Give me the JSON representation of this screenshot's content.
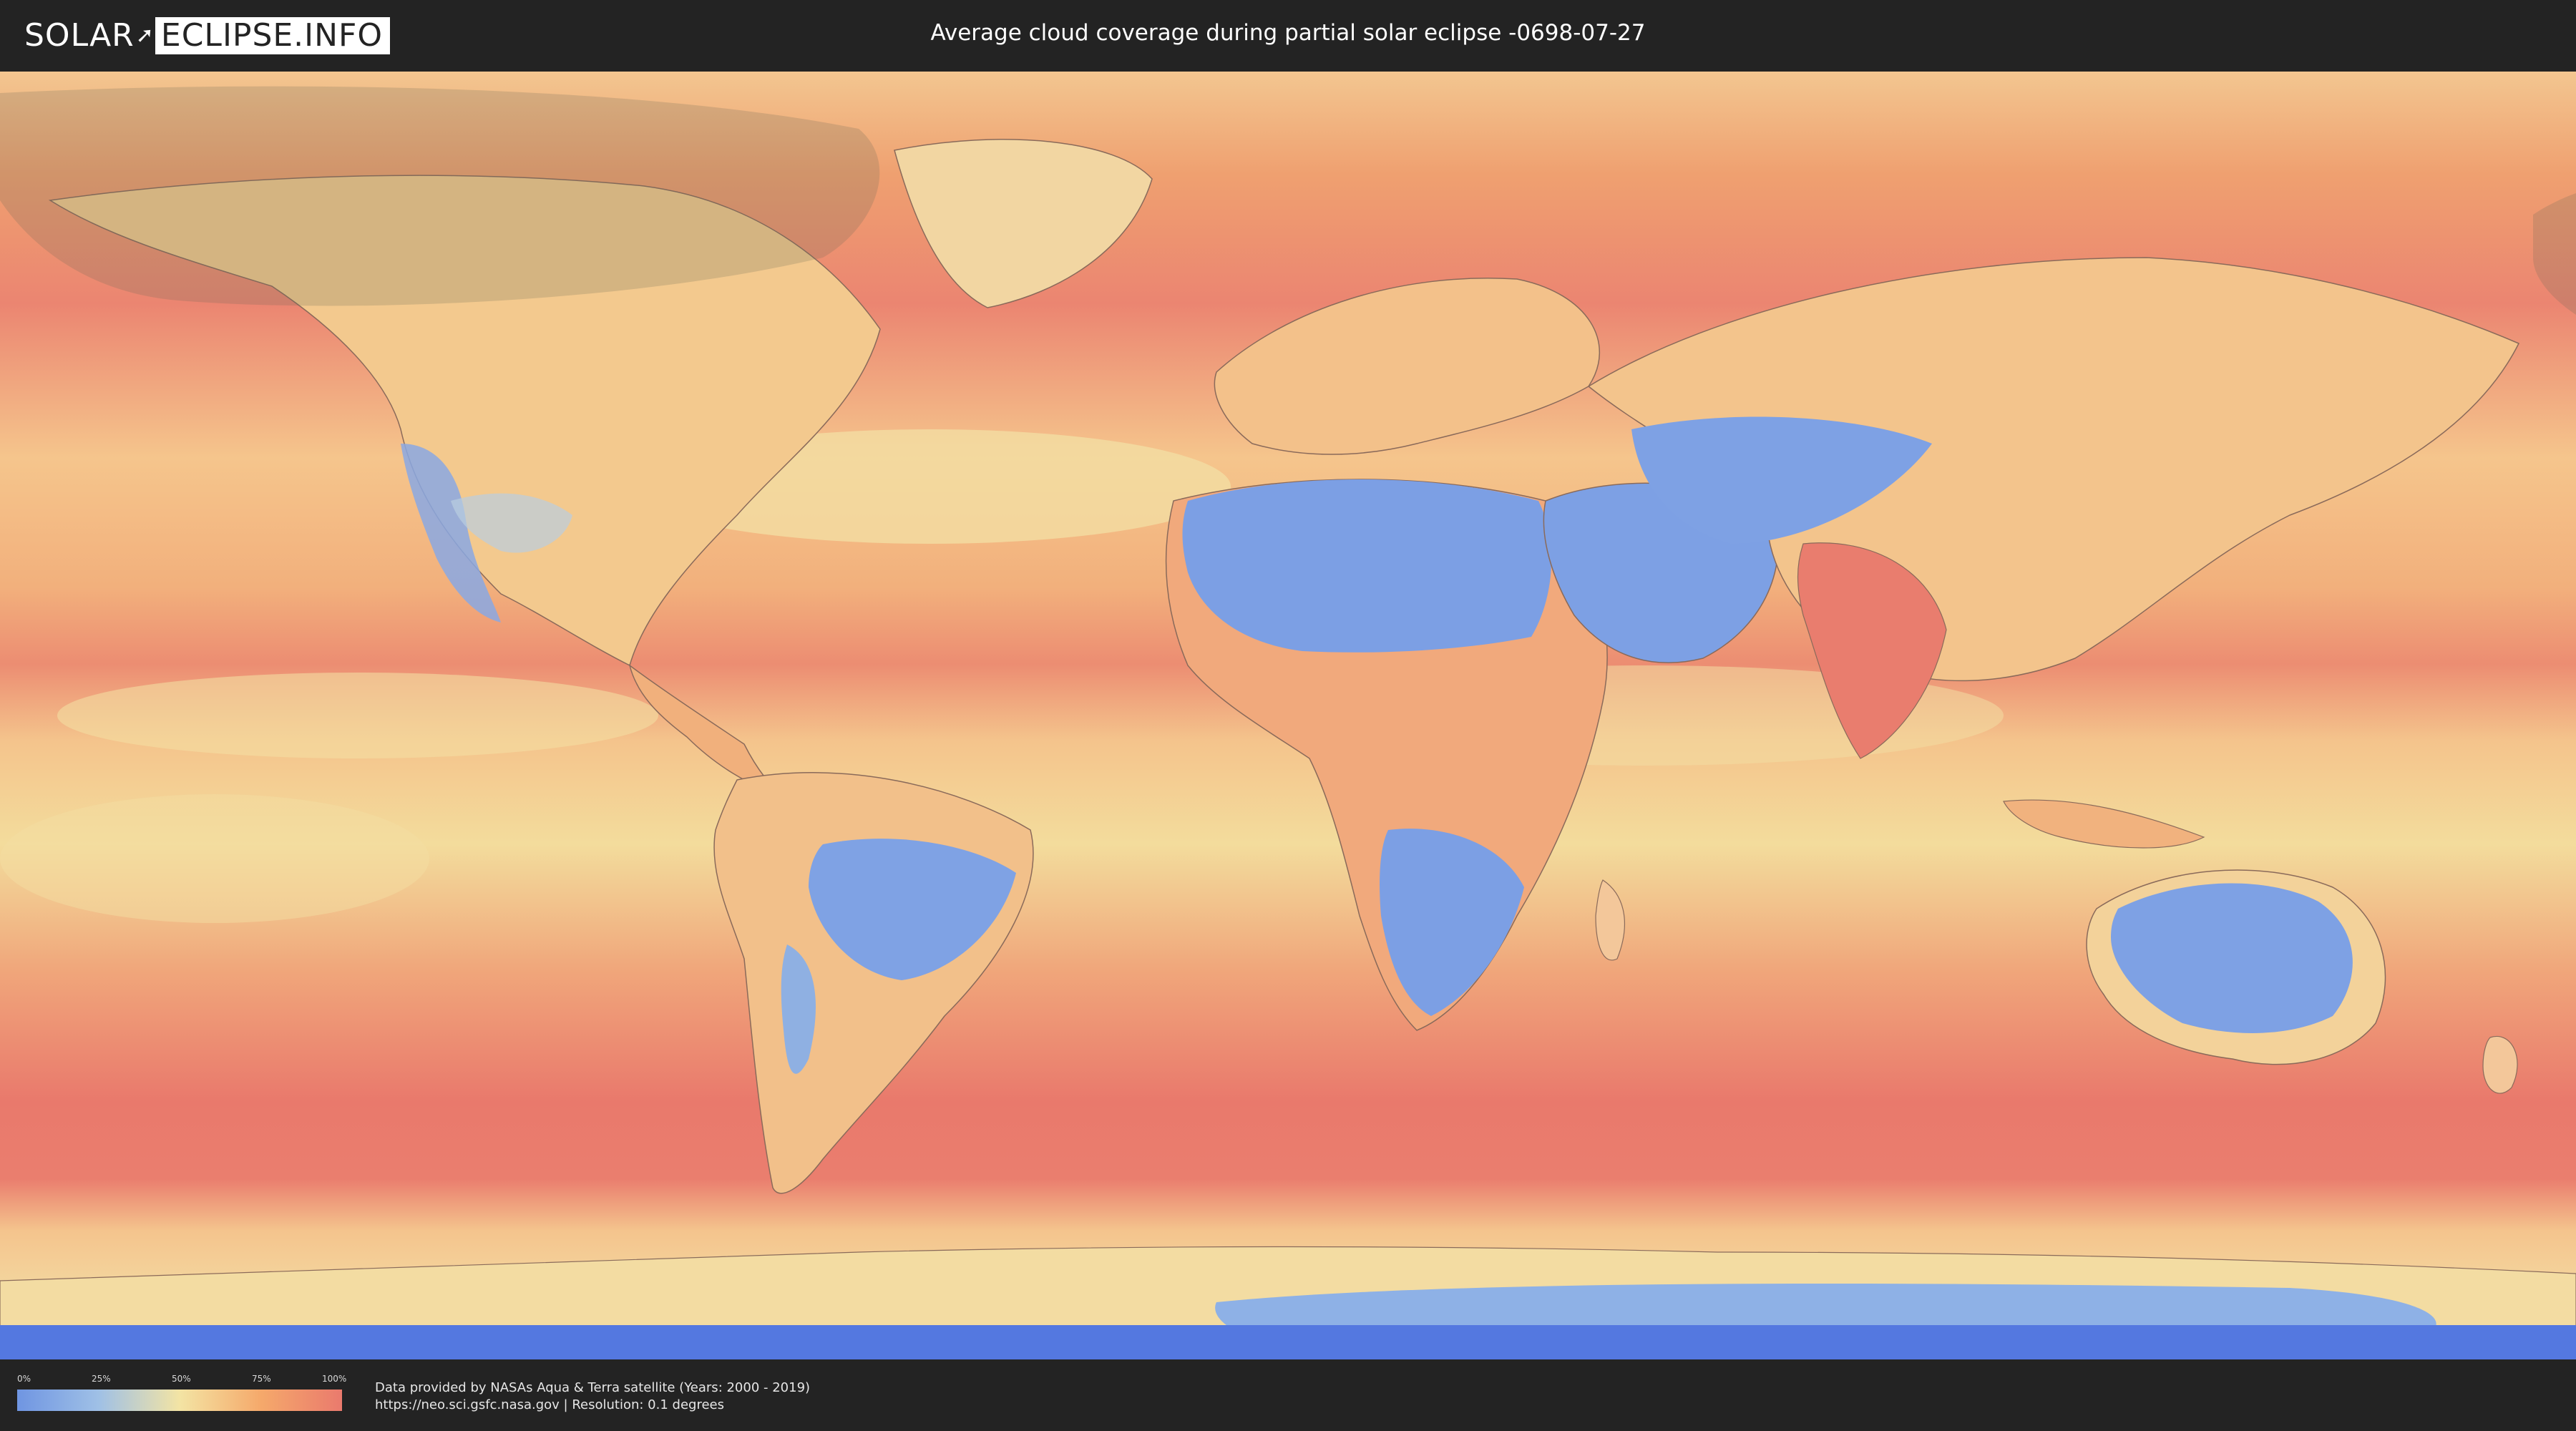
{
  "header": {
    "logo_solar": "SOLAR",
    "logo_eclipse": "ECLIPSE.INFO",
    "title": "Average cloud coverage during partial solar eclipse -0698-07-27"
  },
  "map": {
    "projection": "equirectangular",
    "layer": "average cloud coverage",
    "colors": {
      "ocean_cloudy": "#ea7a6d",
      "mid_cloud": "#f4c98c",
      "low_cloud": "#f3e4a4",
      "clear": "#7d9fe4",
      "shadow_overlay": "#6b6a55"
    }
  },
  "legend": {
    "ticks": [
      "0%",
      "25%",
      "50%",
      "75%",
      "100%"
    ],
    "colors": [
      "#6f95e2",
      "#9fc0e6",
      "#f3e4a4",
      "#f5a96b",
      "#ea7a6d"
    ]
  },
  "footer": {
    "credit_line1": "Data provided by NASAs Aqua & Terra satellite (Years: 2000 - 2019)",
    "credit_line2": "https://neo.sci.gsfc.nasa.gov | Resolution: 0.1 degrees"
  }
}
